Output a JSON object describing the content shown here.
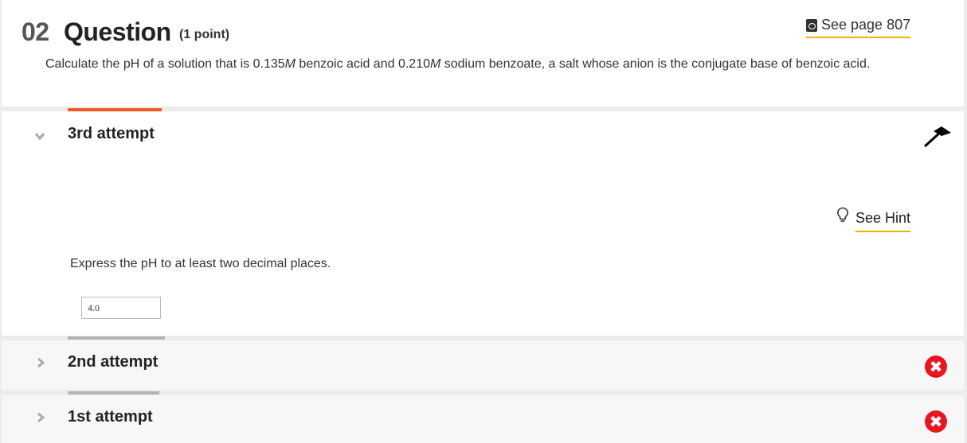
{
  "question": {
    "number": "02",
    "word": "Question",
    "points": "(1 point)",
    "see_page": "See page 807",
    "text_parts": [
      "Calculate the pH of a solution that is 0.135",
      "M",
      " benzoic acid and 0.210",
      "M",
      " sodium benzoate, a salt whose anion is the conjugate base of benzoic acid."
    ]
  },
  "attempts": {
    "third": {
      "title": "3rd attempt",
      "hint_label": "See Hint",
      "instruction": "Express the pH to at least two decimal places.",
      "answer_value": "4.0"
    },
    "second": {
      "title": "2nd attempt"
    },
    "first": {
      "title": "1st attempt"
    }
  },
  "colors": {
    "accent": "#f05a28",
    "hint_underline": "#e8b400",
    "error": "#e8161f"
  },
  "icons": {
    "see_page": "ebook-icon",
    "hint": "lightbulb-icon",
    "expanded": "chevron-down-icon",
    "collapsed": "chevron-right-icon",
    "wrong": "x-circle-icon"
  }
}
